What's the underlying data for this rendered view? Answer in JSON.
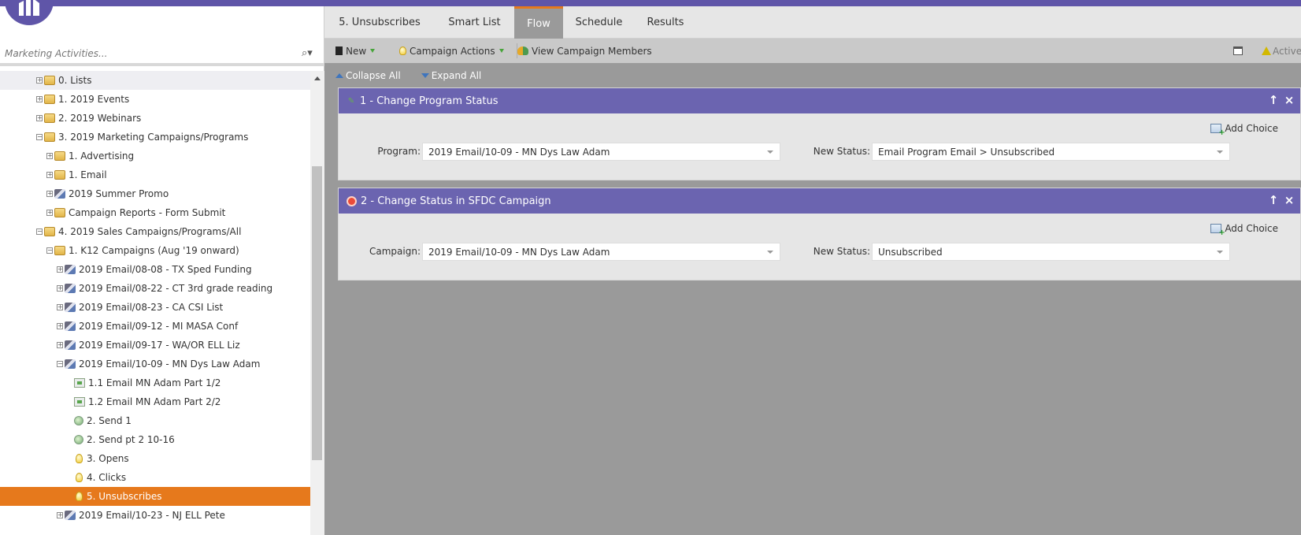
{
  "app": {
    "accent_color": "#5f55a8",
    "selected_color": "#e6791c"
  },
  "search": {
    "placeholder": "Marketing Activities..."
  },
  "tree": [
    {
      "label": "0. Lists",
      "icon": "folder-icon",
      "toggle": "+"
    },
    {
      "label": "1. 2019 Events",
      "icon": "folder-icon",
      "toggle": "+"
    },
    {
      "label": "2. 2019 Webinars",
      "icon": "folder-icon",
      "toggle": "+"
    },
    {
      "label": "3. 2019 Marketing Campaigns/Programs",
      "icon": "folder-icon",
      "toggle": "−"
    },
    {
      "label": "1. Advertising",
      "icon": "folder-icon",
      "toggle": "+"
    },
    {
      "label": "1. Email",
      "icon": "folder-icon",
      "toggle": "+"
    },
    {
      "label": "2019 Summer Promo",
      "icon": "program-icon",
      "toggle": "+"
    },
    {
      "label": "Campaign Reports - Form Submit",
      "icon": "folder-icon",
      "toggle": "+"
    },
    {
      "label": "4. 2019 Sales Campaigns/Programs/All",
      "icon": "folder-icon",
      "toggle": "−"
    },
    {
      "label": "1. K12 Campaigns (Aug '19 onward)",
      "icon": "folder-icon",
      "toggle": "−"
    },
    {
      "label": "2019 Email/08-08 - TX Sped Funding",
      "icon": "program-icon",
      "toggle": "+"
    },
    {
      "label": "2019 Email/08-22 - CT 3rd grade reading",
      "icon": "program-icon",
      "toggle": "+"
    },
    {
      "label": "2019 Email/08-23 - CA CSI List",
      "icon": "program-icon",
      "toggle": "+"
    },
    {
      "label": "2019 Email/09-12 - MI MASA Conf",
      "icon": "program-icon",
      "toggle": "+"
    },
    {
      "label": "2019 Email/09-17 - WA/OR ELL Liz",
      "icon": "program-icon",
      "toggle": "+"
    },
    {
      "label": "2019 Email/10-09 - MN Dys Law Adam",
      "icon": "program-icon",
      "toggle": "−"
    },
    {
      "label": "1.1 Email MN Adam Part 1/2",
      "icon": "email-icon",
      "toggle": ""
    },
    {
      "label": "1.2 Email MN Adam Part 2/2",
      "icon": "email-icon",
      "toggle": ""
    },
    {
      "label": "2. Send 1",
      "icon": "smart-campaign-icon",
      "toggle": ""
    },
    {
      "label": "2. Send pt 2 10-16",
      "icon": "smart-campaign-icon",
      "toggle": ""
    },
    {
      "label": "3. Opens",
      "icon": "trigger-campaign-icon",
      "toggle": ""
    },
    {
      "label": "4. Clicks",
      "icon": "trigger-campaign-icon",
      "toggle": ""
    },
    {
      "label": "5. Unsubscribes",
      "icon": "trigger-campaign-icon",
      "toggle": ""
    },
    {
      "label": "2019 Email/10-23 - NJ ELL Pete",
      "icon": "program-icon",
      "toggle": "+"
    }
  ],
  "tabs": [
    {
      "label": "5. Unsubscribes"
    },
    {
      "label": "Smart List"
    },
    {
      "label": "Flow"
    },
    {
      "label": "Schedule"
    },
    {
      "label": "Results"
    }
  ],
  "toolbar": {
    "new_label": "New",
    "campaign_actions_label": "Campaign Actions",
    "view_members_label": "View Campaign Members",
    "status_label": "Active"
  },
  "flow_controls": {
    "collapse_all": "Collapse All",
    "expand_all": "Expand All"
  },
  "flow_steps": [
    {
      "title": "1 - Change Program Status",
      "add_choice": "Add Choice",
      "field1_label": "Program:",
      "field1_value": "2019 Email/10-09 - MN Dys Law Adam",
      "field2_label": "New Status:",
      "field2_value": "Email Program Email > Unsubscribed"
    },
    {
      "title": "2 - Change Status in SFDC Campaign",
      "add_choice": "Add Choice",
      "field1_label": "Campaign:",
      "field1_value": "2019 Email/10-09 - MN Dys Law Adam",
      "field2_label": "New Status:",
      "field2_value": "Unsubscribed"
    }
  ]
}
